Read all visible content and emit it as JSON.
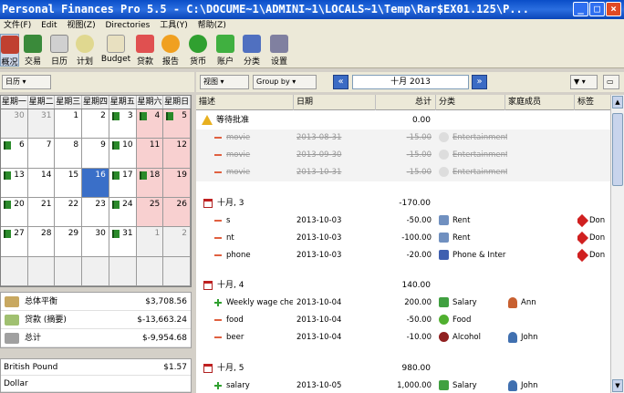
{
  "window": {
    "title": "Personal Finances Pro 5.5 - C:\\DOCUME~1\\ADMINI~1\\LOCALS~1\\Temp\\Rar$EX01.125\\P..."
  },
  "menu": [
    "文件(F)",
    "Edit",
    "视图(Z)",
    "Directories",
    "工具(Y)",
    "帮助(Z)"
  ],
  "toolbar": [
    "概况",
    "交易",
    "日历",
    "计划",
    "Budget",
    "贷款",
    "报告",
    "货币",
    "账户",
    "分类",
    "设置"
  ],
  "leftbar": {
    "mode": "日历"
  },
  "viewbar": {
    "view": "视图",
    "groupby": "Group by",
    "month": "十月 2013"
  },
  "calendar": {
    "weekdays": [
      "星期一",
      "星期二",
      "星期三",
      "星期四",
      "星期五",
      "星期六",
      "星期日"
    ],
    "days": [
      "30",
      "31",
      "1",
      "2",
      "3",
      "4",
      "5",
      "6",
      "7",
      "8",
      "9",
      "10",
      "11",
      "12",
      "13",
      "14",
      "15",
      "16",
      "17",
      "18",
      "19",
      "20",
      "21",
      "22",
      "23",
      "24",
      "25",
      "26",
      "27",
      "28",
      "29",
      "30",
      "31",
      "1",
      "2"
    ]
  },
  "summary": [
    {
      "label": "总体平衡",
      "value": "$3,708.56"
    },
    {
      "label": "贷款 (摘要)",
      "value": "$-13,663.24"
    },
    {
      "label": "总计",
      "value": "$-9,954.68"
    }
  ],
  "currencies": [
    {
      "name": "British Pound",
      "value": "$1.57"
    },
    {
      "name": "Dollar",
      "value": ""
    }
  ],
  "columns": [
    "描述",
    "日期",
    "总计",
    "分类",
    "家庭成员",
    "标签"
  ],
  "pending": {
    "label": "等待批准",
    "total": "0.00"
  },
  "rows_pending": [
    {
      "desc": "movie",
      "date": "2013-08-31",
      "total": "-15.00",
      "cat": "Entertainment"
    },
    {
      "desc": "movie",
      "date": "2013-09-30",
      "total": "-15.00",
      "cat": "Entertainment"
    },
    {
      "desc": "movie",
      "date": "2013-10-31",
      "total": "-15.00",
      "cat": "Entertainment"
    }
  ],
  "group1": {
    "label": "十月, 3",
    "total": "-170.00"
  },
  "rows1": [
    {
      "desc": "s",
      "date": "2013-10-03",
      "total": "-50.00",
      "cat": "Rent",
      "tag": "Don"
    },
    {
      "desc": "nt",
      "date": "2013-10-03",
      "total": "-100.00",
      "cat": "Rent",
      "tag": "Don"
    },
    {
      "desc": "phone",
      "date": "2013-10-03",
      "total": "-20.00",
      "cat": "Phone & Inter",
      "tag": "Don"
    }
  ],
  "group2": {
    "label": "十月, 4",
    "total": "140.00"
  },
  "rows2": [
    {
      "desc": "Weekly wage chec",
      "date": "2013-10-04",
      "total": "200.00",
      "cat": "Salary",
      "member": "Ann"
    },
    {
      "desc": "food",
      "date": "2013-10-04",
      "total": "-50.00",
      "cat": "Food",
      "member": ""
    },
    {
      "desc": "beer",
      "date": "2013-10-04",
      "total": "-10.00",
      "cat": "Alcohol",
      "member": "John"
    }
  ],
  "group3": {
    "label": "十月, 5",
    "total": "980.00"
  },
  "rows3": [
    {
      "desc": "salary",
      "date": "2013-10-05",
      "total": "1,000.00",
      "cat": "Salary",
      "member": "John"
    }
  ]
}
